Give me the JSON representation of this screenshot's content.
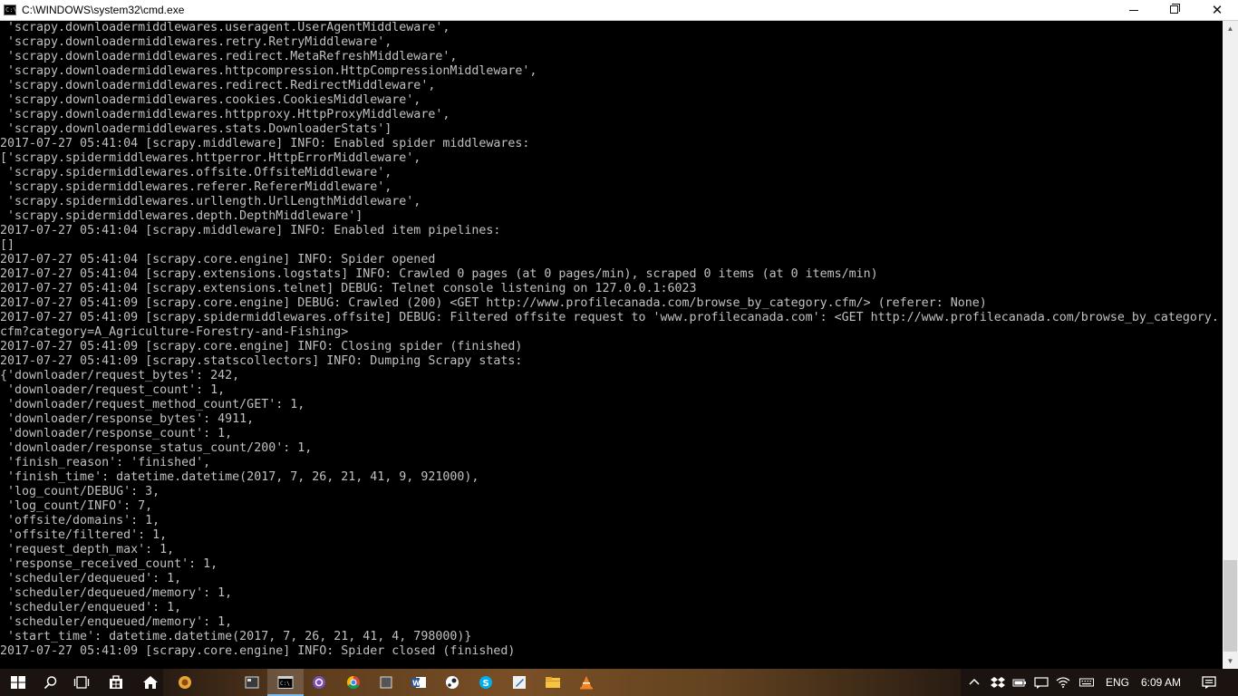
{
  "window": {
    "title": "C:\\WINDOWS\\system32\\cmd.exe",
    "app_icon_text": "C:\\"
  },
  "console": {
    "lines": [
      " 'scrapy.downloadermiddlewares.useragent.UserAgentMiddleware',",
      " 'scrapy.downloadermiddlewares.retry.RetryMiddleware',",
      " 'scrapy.downloadermiddlewares.redirect.MetaRefreshMiddleware',",
      " 'scrapy.downloadermiddlewares.httpcompression.HttpCompressionMiddleware',",
      " 'scrapy.downloadermiddlewares.redirect.RedirectMiddleware',",
      " 'scrapy.downloadermiddlewares.cookies.CookiesMiddleware',",
      " 'scrapy.downloadermiddlewares.httpproxy.HttpProxyMiddleware',",
      " 'scrapy.downloadermiddlewares.stats.DownloaderStats']",
      "2017-07-27 05:41:04 [scrapy.middleware] INFO: Enabled spider middlewares:",
      "['scrapy.spidermiddlewares.httperror.HttpErrorMiddleware',",
      " 'scrapy.spidermiddlewares.offsite.OffsiteMiddleware',",
      " 'scrapy.spidermiddlewares.referer.RefererMiddleware',",
      " 'scrapy.spidermiddlewares.urllength.UrlLengthMiddleware',",
      " 'scrapy.spidermiddlewares.depth.DepthMiddleware']",
      "2017-07-27 05:41:04 [scrapy.middleware] INFO: Enabled item pipelines:",
      "[]",
      "2017-07-27 05:41:04 [scrapy.core.engine] INFO: Spider opened",
      "2017-07-27 05:41:04 [scrapy.extensions.logstats] INFO: Crawled 0 pages (at 0 pages/min), scraped 0 items (at 0 items/min)",
      "2017-07-27 05:41:04 [scrapy.extensions.telnet] DEBUG: Telnet console listening on 127.0.0.1:6023",
      "2017-07-27 05:41:09 [scrapy.core.engine] DEBUG: Crawled (200) <GET http://www.profilecanada.com/browse_by_category.cfm/> (referer: None)",
      "2017-07-27 05:41:09 [scrapy.spidermiddlewares.offsite] DEBUG: Filtered offsite request to 'www.profilecanada.com': <GET http://www.profilecanada.com/browse_by_category.",
      "cfm?category=A_Agriculture-Forestry-and-Fishing>",
      "2017-07-27 05:41:09 [scrapy.core.engine] INFO: Closing spider (finished)",
      "2017-07-27 05:41:09 [scrapy.statscollectors] INFO: Dumping Scrapy stats:",
      "{'downloader/request_bytes': 242,",
      " 'downloader/request_count': 1,",
      " 'downloader/request_method_count/GET': 1,",
      " 'downloader/response_bytes': 4911,",
      " 'downloader/response_count': 1,",
      " 'downloader/response_status_count/200': 1,",
      " 'finish_reason': 'finished',",
      " 'finish_time': datetime.datetime(2017, 7, 26, 21, 41, 9, 921000),",
      " 'log_count/DEBUG': 3,",
      " 'log_count/INFO': 7,",
      " 'offsite/domains': 1,",
      " 'offsite/filtered': 1,",
      " 'request_depth_max': 1,",
      " 'response_received_count': 1,",
      " 'scheduler/dequeued': 1,",
      " 'scheduler/dequeued/memory': 1,",
      " 'scheduler/enqueued': 1,",
      " 'scheduler/enqueued/memory': 1,",
      " 'start_time': datetime.datetime(2017, 7, 26, 21, 41, 4, 798000)}",
      "2017-07-27 05:41:09 [scrapy.core.engine] INFO: Spider closed (finished)"
    ],
    "text_color": "#c0c0c0",
    "background": "#000000"
  },
  "taskbar": {
    "pinned_icons": [
      "windows-start-icon",
      "search-icon",
      "task-view-icon",
      "store-icon",
      "home-icon",
      "app-icon",
      "app-icon",
      "cmd-icon",
      "app-icon",
      "chrome-icon",
      "app-icon",
      "word-icon",
      "steam-icon",
      "skype-icon",
      "app-icon",
      "file-explorer-icon",
      "vlc-icon"
    ],
    "active_item": "cmd-icon",
    "language": "ENG",
    "time": "6:09 AM"
  },
  "colors": {
    "accent": "#76b9ed",
    "titlebar_bg": "#ffffff",
    "scrollbar_bg": "#f0f0f0",
    "scroll_thumb": "#cdcdcd"
  }
}
